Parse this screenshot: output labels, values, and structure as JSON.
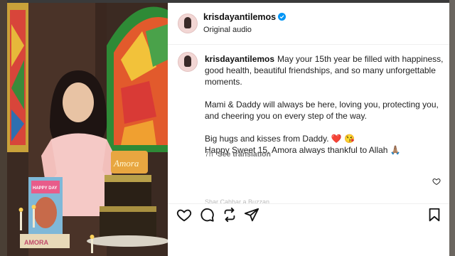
{
  "post": {
    "username": "krisdayantilemos",
    "audio_label": "Original audio",
    "caption_paragraphs": [
      "May your 15th year be filled with happiness, good health, beautiful friendships, and so many unforgettable moments.",
      "Mami & Daddy will always be here, loving you, protecting you, and cheering you on every step of the way."
    ],
    "caption_line_a": "Big hugs and kisses from Daddy. ❤️ 😘",
    "caption_line_b": "Happy Sweet 15, Amora always thankful to Allah 🙏🏽",
    "timestamp": "7h",
    "see_translation": "See translation",
    "faded_text": "Shar Cahbar a Buzzan"
  },
  "media": {
    "cake_topper": "Amora",
    "cake_side": "AMORA",
    "poster_text": "HAPPY DAY"
  },
  "icons": [
    "verified-icon",
    "heart-icon",
    "comment-icon",
    "repost-icon",
    "share-icon",
    "save-icon"
  ],
  "colors": {
    "verified": "#0095f6",
    "text": "#222222",
    "muted": "#737373"
  }
}
